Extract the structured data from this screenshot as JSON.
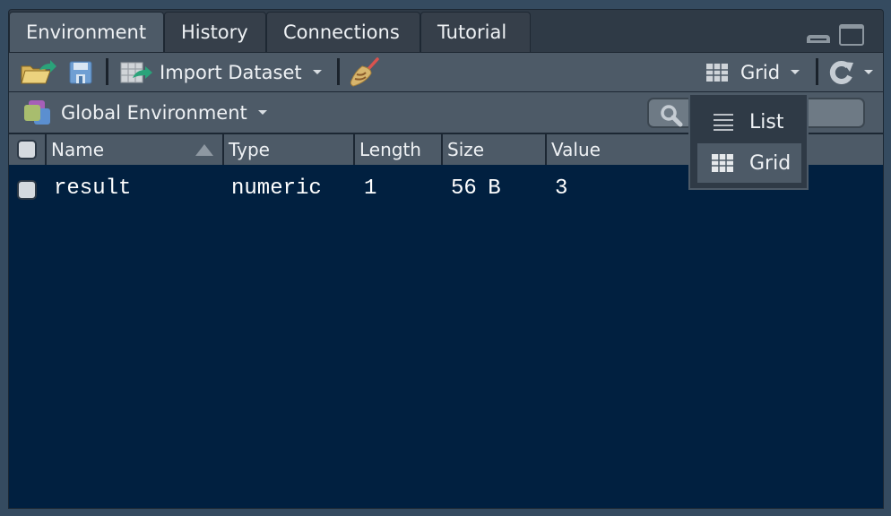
{
  "tabs": [
    {
      "label": "Environment",
      "active": true
    },
    {
      "label": "History",
      "active": false
    },
    {
      "label": "Connections",
      "active": false
    },
    {
      "label": "Tutorial",
      "active": false
    }
  ],
  "toolbar": {
    "import_dataset_label": "Import Dataset",
    "view_mode_label": "Grid"
  },
  "environment": {
    "selector_label": "Global Environment",
    "search_placeholder": ""
  },
  "table": {
    "columns": [
      "Name",
      "Type",
      "Length",
      "Size",
      "Value"
    ],
    "sort_column": "Name",
    "sort_direction": "ascending",
    "rows": [
      {
        "name": "result",
        "type": "numeric",
        "length": "1",
        "size": "56 B",
        "value": "3"
      }
    ]
  },
  "view_menu": {
    "items": [
      {
        "label": "List",
        "icon": "list-icon",
        "selected": false
      },
      {
        "label": "Grid",
        "icon": "grid-icon",
        "selected": true
      }
    ]
  },
  "colors": {
    "background": "#354b60",
    "panel": "#4d5a67",
    "table_body": "#012040",
    "accent_green": "#2aa37a"
  }
}
